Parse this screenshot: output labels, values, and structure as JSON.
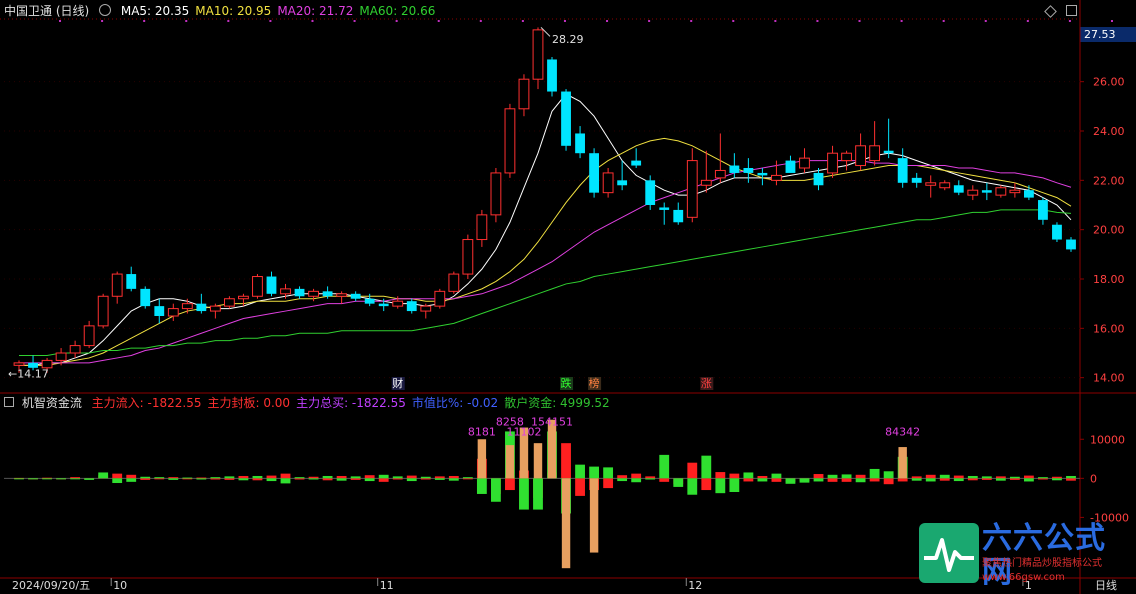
{
  "title": "中国卫通 (日线)",
  "ma_legend": [
    {
      "label": "MA5: 20.35",
      "color": "#ffffff"
    },
    {
      "label": "MA10: 20.95",
      "color": "#f0e040"
    },
    {
      "label": "MA20: 21.72",
      "color": "#e040e0"
    },
    {
      "label": "MA60: 20.66",
      "color": "#30d030"
    }
  ],
  "current_price": "27.53",
  "price_axis": [
    "26.00",
    "24.00",
    "22.00",
    "20.00",
    "18.00",
    "16.00",
    "14.00"
  ],
  "high_label": "28.29",
  "low_label": "14.17",
  "event_tags": [
    {
      "label": "财",
      "color": "#ffffff",
      "bg": "#1a1a40"
    },
    {
      "label": "跌",
      "color": "#30ff30",
      "bg": "#1a3a1a"
    },
    {
      "label": "榜",
      "color": "#ff8040",
      "bg": "#3a2a1a"
    },
    {
      "label": "涨",
      "color": "#ff4040",
      "bg": "#3a1a1a"
    }
  ],
  "indicator": {
    "name": "机智资金流",
    "items": [
      {
        "label": "主力流入: -1822.55",
        "color": "#ff3030"
      },
      {
        "label": "主力封板: 0.00",
        "color": "#ff3030"
      },
      {
        "label": "主力总买: -1822.55",
        "color": "#c040ff"
      },
      {
        "label": "市值比%: -0.02",
        "color": "#4060ff"
      },
      {
        "label": "散户资金: 4999.52",
        "color": "#30c030"
      }
    ],
    "axis": [
      "10000",
      "0",
      "-10000"
    ],
    "peak_labels": [
      "8181",
      "8258",
      "11102",
      "154151",
      "84342"
    ]
  },
  "date_axis": {
    "first_date": "2024/09/20/五",
    "months": [
      "10",
      "11",
      "12",
      "1"
    ],
    "period": "日线"
  },
  "brand": {
    "name": "六六公式网",
    "slogan": "聚焦热门精品炒股指标公式",
    "url": "www.66gsw.com"
  },
  "colors": {
    "up": "#ff3030",
    "down": "#00e5ff",
    "bg": "#000000",
    "grid": "#8b0000"
  },
  "chart_data": [
    {
      "type": "candlestick",
      "title": "中国卫通 (日线)",
      "ylim": [
        13.5,
        28.5
      ],
      "ohlc": [
        [
          14.5,
          14.7,
          14.2,
          14.6
        ],
        [
          14.6,
          14.9,
          14.3,
          14.4
        ],
        [
          14.4,
          14.8,
          14.2,
          14.7
        ],
        [
          14.7,
          15.2,
          14.5,
          15.0
        ],
        [
          15.0,
          15.5,
          14.8,
          15.3
        ],
        [
          15.3,
          16.3,
          15.2,
          16.1
        ],
        [
          16.1,
          17.4,
          16.0,
          17.3
        ],
        [
          17.3,
          18.3,
          17.0,
          18.2
        ],
        [
          18.2,
          18.5,
          17.5,
          17.6
        ],
        [
          17.6,
          17.7,
          16.8,
          16.9
        ],
        [
          16.9,
          17.2,
          16.2,
          16.5
        ],
        [
          16.5,
          17.0,
          16.3,
          16.8
        ],
        [
          16.8,
          17.2,
          16.6,
          17.0
        ],
        [
          17.0,
          17.4,
          16.6,
          16.7
        ],
        [
          16.7,
          17.0,
          16.4,
          16.9
        ],
        [
          16.9,
          17.3,
          16.8,
          17.2
        ],
        [
          17.2,
          17.4,
          16.9,
          17.3
        ],
        [
          17.3,
          18.2,
          17.2,
          18.1
        ],
        [
          18.1,
          18.3,
          17.3,
          17.4
        ],
        [
          17.4,
          17.8,
          17.2,
          17.6
        ],
        [
          17.6,
          17.7,
          17.2,
          17.3
        ],
        [
          17.3,
          17.6,
          17.1,
          17.5
        ],
        [
          17.5,
          17.7,
          17.2,
          17.3
        ],
        [
          17.3,
          17.5,
          17.0,
          17.4
        ],
        [
          17.4,
          17.5,
          17.1,
          17.2
        ],
        [
          17.2,
          17.4,
          16.9,
          17.0
        ],
        [
          17.0,
          17.2,
          16.7,
          16.9
        ],
        [
          16.9,
          17.3,
          16.8,
          17.1
        ],
        [
          17.1,
          17.2,
          16.6,
          16.7
        ],
        [
          16.7,
          17.0,
          16.4,
          16.9
        ],
        [
          16.9,
          17.6,
          16.8,
          17.5
        ],
        [
          17.5,
          18.3,
          17.4,
          18.2
        ],
        [
          18.2,
          19.8,
          18.0,
          19.6
        ],
        [
          19.6,
          20.8,
          19.3,
          20.6
        ],
        [
          20.6,
          22.5,
          20.3,
          22.3
        ],
        [
          22.3,
          25.1,
          22.1,
          24.9
        ],
        [
          24.9,
          26.3,
          24.6,
          26.1
        ],
        [
          26.1,
          28.2,
          25.7,
          28.1
        ],
        [
          26.9,
          27.0,
          25.4,
          25.6
        ],
        [
          25.6,
          25.7,
          23.2,
          23.4
        ],
        [
          23.9,
          24.2,
          22.9,
          23.1
        ],
        [
          23.1,
          23.3,
          21.3,
          21.5
        ],
        [
          21.5,
          22.5,
          21.3,
          22.3
        ],
        [
          22.0,
          22.8,
          21.6,
          21.8
        ],
        [
          22.8,
          23.3,
          22.5,
          22.6
        ],
        [
          22.0,
          22.2,
          20.8,
          21.0
        ],
        [
          20.9,
          21.1,
          20.2,
          20.8
        ],
        [
          20.8,
          21.1,
          20.2,
          20.3
        ],
        [
          20.5,
          23.3,
          20.3,
          22.8
        ],
        [
          21.8,
          23.2,
          21.5,
          22.0
        ],
        [
          22.1,
          23.9,
          21.9,
          22.4
        ],
        [
          22.6,
          23.1,
          22.1,
          22.3
        ],
        [
          22.5,
          22.9,
          21.9,
          22.3
        ],
        [
          22.3,
          22.5,
          21.8,
          22.2
        ],
        [
          22.0,
          22.8,
          21.8,
          22.2
        ],
        [
          22.8,
          23.0,
          22.4,
          22.3
        ],
        [
          22.5,
          23.3,
          22.3,
          22.9
        ],
        [
          22.3,
          22.5,
          21.6,
          21.8
        ],
        [
          22.3,
          23.4,
          22.1,
          23.1
        ],
        [
          22.8,
          23.2,
          22.4,
          23.1
        ],
        [
          22.6,
          23.9,
          22.4,
          23.4
        ],
        [
          22.8,
          24.4,
          22.6,
          23.4
        ],
        [
          23.2,
          24.5,
          22.9,
          23.1
        ],
        [
          22.9,
          23.3,
          21.7,
          21.9
        ],
        [
          22.1,
          22.3,
          21.7,
          21.9
        ],
        [
          21.8,
          22.2,
          21.3,
          21.9
        ],
        [
          21.7,
          22.0,
          21.6,
          21.9
        ],
        [
          21.8,
          22.0,
          21.4,
          21.5
        ],
        [
          21.4,
          21.8,
          21.2,
          21.6
        ],
        [
          21.6,
          21.9,
          21.2,
          21.5
        ],
        [
          21.4,
          21.8,
          21.3,
          21.7
        ],
        [
          21.5,
          21.9,
          21.3,
          21.6
        ],
        [
          21.6,
          21.8,
          21.2,
          21.3
        ],
        [
          21.2,
          21.3,
          20.2,
          20.4
        ],
        [
          20.2,
          20.3,
          19.5,
          19.6
        ],
        [
          19.6,
          19.7,
          19.1,
          19.2
        ]
      ],
      "series": [
        {
          "name": "MA5",
          "values": [
            14.5,
            14.5,
            14.6,
            14.6,
            14.8,
            15.0,
            15.5,
            16.1,
            16.7,
            17.0,
            17.2,
            17.2,
            17.1,
            16.9,
            16.8,
            16.8,
            16.9,
            17.1,
            17.2,
            17.3,
            17.4,
            17.4,
            17.4,
            17.4,
            17.3,
            17.2,
            17.1,
            17.0,
            17.0,
            16.9,
            17.0,
            17.3,
            17.8,
            18.4,
            19.2,
            20.3,
            21.7,
            23.1,
            24.8,
            25.5,
            25.2,
            24.6,
            23.7,
            22.8,
            22.2,
            21.9,
            21.6,
            21.4,
            21.4,
            21.6,
            21.9,
            22.1,
            22.1,
            22.1,
            22.1,
            22.2,
            22.3,
            22.4,
            22.5,
            22.6,
            22.8,
            23.0,
            23.1,
            23.0,
            22.8,
            22.6,
            22.4,
            22.2,
            22.0,
            21.9,
            21.8,
            21.7,
            21.6,
            21.3,
            21.0,
            20.4
          ]
        },
        {
          "name": "MA10",
          "values": [
            14.5,
            14.5,
            14.5,
            14.6,
            14.7,
            14.8,
            15.0,
            15.3,
            15.6,
            15.9,
            16.2,
            16.5,
            16.7,
            16.8,
            16.9,
            17.0,
            17.0,
            17.1,
            17.1,
            17.1,
            17.2,
            17.2,
            17.3,
            17.3,
            17.3,
            17.3,
            17.3,
            17.2,
            17.2,
            17.1,
            17.1,
            17.2,
            17.4,
            17.6,
            17.9,
            18.3,
            18.8,
            19.5,
            20.3,
            21.1,
            21.8,
            22.4,
            22.8,
            23.1,
            23.4,
            23.6,
            23.7,
            23.6,
            23.4,
            23.1,
            22.8,
            22.5,
            22.3,
            22.1,
            22.0,
            22.0,
            22.0,
            22.1,
            22.2,
            22.3,
            22.4,
            22.5,
            22.6,
            22.6,
            22.6,
            22.5,
            22.4,
            22.3,
            22.2,
            22.1,
            22.0,
            21.9,
            21.7,
            21.5,
            21.3,
            20.95
          ]
        },
        {
          "name": "MA20",
          "values": [
            14.6,
            14.6,
            14.6,
            14.6,
            14.6,
            14.6,
            14.7,
            14.8,
            14.9,
            15.1,
            15.2,
            15.4,
            15.6,
            15.8,
            16.0,
            16.2,
            16.4,
            16.5,
            16.6,
            16.7,
            16.8,
            16.9,
            17.0,
            17.0,
            17.1,
            17.1,
            17.1,
            17.2,
            17.2,
            17.2,
            17.2,
            17.2,
            17.3,
            17.4,
            17.6,
            17.8,
            18.1,
            18.4,
            18.7,
            19.1,
            19.5,
            19.9,
            20.2,
            20.5,
            20.8,
            21.1,
            21.3,
            21.5,
            21.7,
            21.9,
            22.1,
            22.3,
            22.4,
            22.5,
            22.6,
            22.7,
            22.8,
            22.8,
            22.8,
            22.8,
            22.8,
            22.7,
            22.7,
            22.6,
            22.6,
            22.6,
            22.6,
            22.5,
            22.5,
            22.4,
            22.3,
            22.3,
            22.2,
            22.1,
            21.9,
            21.72
          ]
        },
        {
          "name": "MA60",
          "values": [
            14.9,
            14.9,
            14.9,
            15.0,
            15.0,
            15.0,
            15.1,
            15.1,
            15.2,
            15.2,
            15.3,
            15.3,
            15.4,
            15.4,
            15.5,
            15.5,
            15.6,
            15.6,
            15.7,
            15.7,
            15.8,
            15.8,
            15.8,
            15.9,
            15.9,
            15.9,
            15.9,
            15.9,
            15.9,
            16.0,
            16.1,
            16.2,
            16.4,
            16.6,
            16.8,
            17.0,
            17.2,
            17.4,
            17.6,
            17.8,
            17.9,
            18.1,
            18.2,
            18.3,
            18.4,
            18.5,
            18.6,
            18.7,
            18.8,
            18.9,
            19.0,
            19.1,
            19.2,
            19.3,
            19.4,
            19.5,
            19.6,
            19.7,
            19.8,
            19.9,
            20.0,
            20.1,
            20.2,
            20.3,
            20.4,
            20.4,
            20.5,
            20.6,
            20.7,
            20.7,
            20.8,
            20.8,
            20.8,
            20.8,
            20.7,
            20.66
          ]
        }
      ]
    },
    {
      "type": "bar",
      "title": "机智资金流",
      "ylim": [
        -25000,
        18000
      ],
      "series": [
        {
          "name": "主力",
          "values": [
            100,
            -80,
            150,
            -50,
            300,
            -150,
            800,
            1200,
            900,
            -400,
            -200,
            300,
            -150,
            200,
            -300,
            -400,
            600,
            -500,
            700,
            1200,
            -300,
            400,
            -500,
            600,
            -400,
            800,
            -900,
            -300,
            700,
            -300,
            500,
            600,
            -200,
            5000,
            -4000,
            -3000,
            2000,
            -5000,
            1500,
            9000,
            -4500,
            -3000,
            -2500,
            800,
            1200,
            500,
            -900,
            -1500,
            4000,
            -3000,
            1600,
            1200,
            -800,
            600,
            -900,
            -900,
            -700,
            1100,
            -900,
            -900,
            900,
            -800,
            -1500,
            -800,
            500,
            900,
            -600,
            700,
            -500,
            -400,
            500,
            -400,
            700,
            -300,
            400,
            -600
          ]
        },
        {
          "name": "散户",
          "values": [
            -50,
            -100,
            0,
            -100,
            -200,
            -400,
            1500,
            -1200,
            -900,
            400,
            300,
            -400,
            200,
            -300,
            300,
            500,
            -500,
            600,
            -700,
            -1300,
            300,
            -300,
            600,
            -600,
            500,
            -700,
            900,
            500,
            -700,
            400,
            -400,
            -600,
            300,
            -4000,
            -6000,
            12000,
            -8000,
            -8000,
            12000,
            -9000,
            3500,
            3000,
            2800,
            -700,
            -1000,
            -300,
            6000,
            -2200,
            -4200,
            5800,
            -3800,
            -3500,
            1500,
            -800,
            1200,
            -1400,
            -1100,
            -800,
            900,
            1000,
            -1000,
            2400,
            1800,
            5500,
            -600,
            -800,
            900,
            -700,
            600,
            500,
            -600,
            400,
            -800,
            300,
            -500,
            600
          ]
        }
      ],
      "peak_markers": [
        {
          "index": 33,
          "label": "8181"
        },
        {
          "index": 35,
          "label": "8258"
        },
        {
          "index": 36,
          "label": "11102"
        },
        {
          "index": 38,
          "label": "154151"
        },
        {
          "index": 63,
          "label": "84342"
        }
      ]
    }
  ]
}
